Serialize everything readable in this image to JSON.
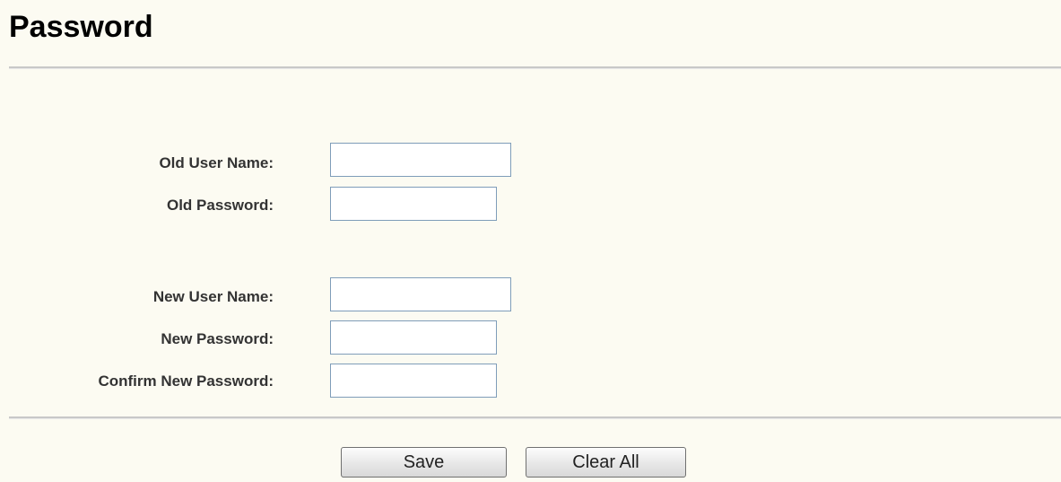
{
  "page": {
    "title": "Password"
  },
  "form": {
    "old_user_name": {
      "label": "Old User Name:",
      "value": ""
    },
    "old_password": {
      "label": "Old Password:",
      "value": ""
    },
    "new_user_name": {
      "label": "New User Name:",
      "value": ""
    },
    "new_password": {
      "label": "New Password:",
      "value": ""
    },
    "confirm_new_password": {
      "label": "Confirm New Password:",
      "value": ""
    }
  },
  "actions": {
    "save_label": "Save",
    "clear_all_label": "Clear All"
  },
  "colors": {
    "background": "#fcfbf2",
    "divider": "#c8c8c8",
    "input_border": "#7f9db9"
  }
}
